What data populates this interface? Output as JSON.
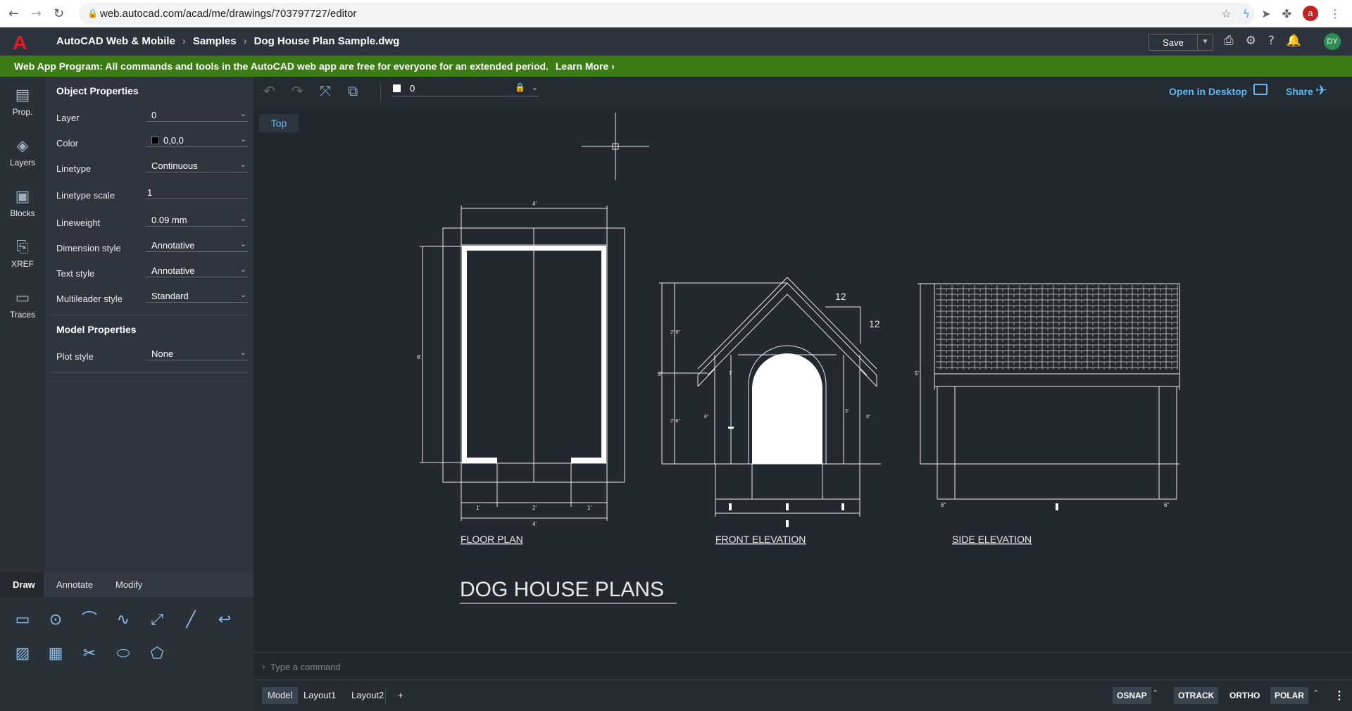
{
  "browser": {
    "url": "web.autocad.com/acad/me/drawings/703797727/editor",
    "profile_initial": "a"
  },
  "app": {
    "logo": "A",
    "breadcrumb": [
      "AutoCAD Web & Mobile",
      "Samples",
      "Dog House Plan Sample.dwg"
    ],
    "save_label": "Save",
    "user_initials": "DY"
  },
  "banner": {
    "text": "Web App Program: All commands and tools in the AutoCAD web app are free for everyone for an extended period.",
    "link": "Learn More ›"
  },
  "rail": [
    {
      "label": "Prop."
    },
    {
      "label": "Layers"
    },
    {
      "label": "Blocks"
    },
    {
      "label": "XREF"
    },
    {
      "label": "Traces"
    }
  ],
  "object_properties": {
    "title": "Object Properties",
    "rows": [
      {
        "label": "Layer",
        "value": "0"
      },
      {
        "label": "Color",
        "value": "0,0,0"
      },
      {
        "label": "Linetype",
        "value": "Continuous"
      },
      {
        "label": "Linetype scale",
        "value": "1"
      },
      {
        "label": "Lineweight",
        "value": "0.09 mm"
      },
      {
        "label": "Dimension style",
        "value": "Annotative"
      },
      {
        "label": "Text style",
        "value": "Annotative"
      },
      {
        "label": "Multileader style",
        "value": "Standard"
      }
    ]
  },
  "model_properties": {
    "title": "Model Properties",
    "rows": [
      {
        "label": "Plot style",
        "value": "None"
      }
    ]
  },
  "palette": {
    "tabs": [
      "Draw",
      "Annotate",
      "Modify"
    ]
  },
  "toolbar": {
    "layer": "0",
    "open_desktop": "Open in Desktop",
    "share": "Share"
  },
  "view_label": "Top",
  "drawing": {
    "title": "DOG HOUSE PLANS",
    "floor_plan": "FLOOR PLAN",
    "front_elevation": "FRONT ELEVATION",
    "side_elevation": "SIDE ELEVATION",
    "slope_rise": "12",
    "slope_run": "12",
    "dim_4ft": "4'",
    "dim_6ft": "6'",
    "dim_5ft": "5'",
    "dim_1ft": "1'",
    "dim_2ft": "2'",
    "dim_3ft": "3'",
    "dim_2ft6": "2'-6\"",
    "dim_6in": "6\""
  },
  "command": {
    "placeholder": "Type a command"
  },
  "status": {
    "layouts": [
      "Model",
      "Layout1",
      "Layout2"
    ],
    "add": "+",
    "toggles": [
      "OSNAP",
      "OTRACK",
      "ORTHO",
      "POLAR"
    ],
    "menu": "⋮"
  },
  "colors": {
    "accent": "#5fb8f0",
    "banner": "#3b7c14",
    "logo": "#e51b24",
    "canvas": "#212830"
  }
}
